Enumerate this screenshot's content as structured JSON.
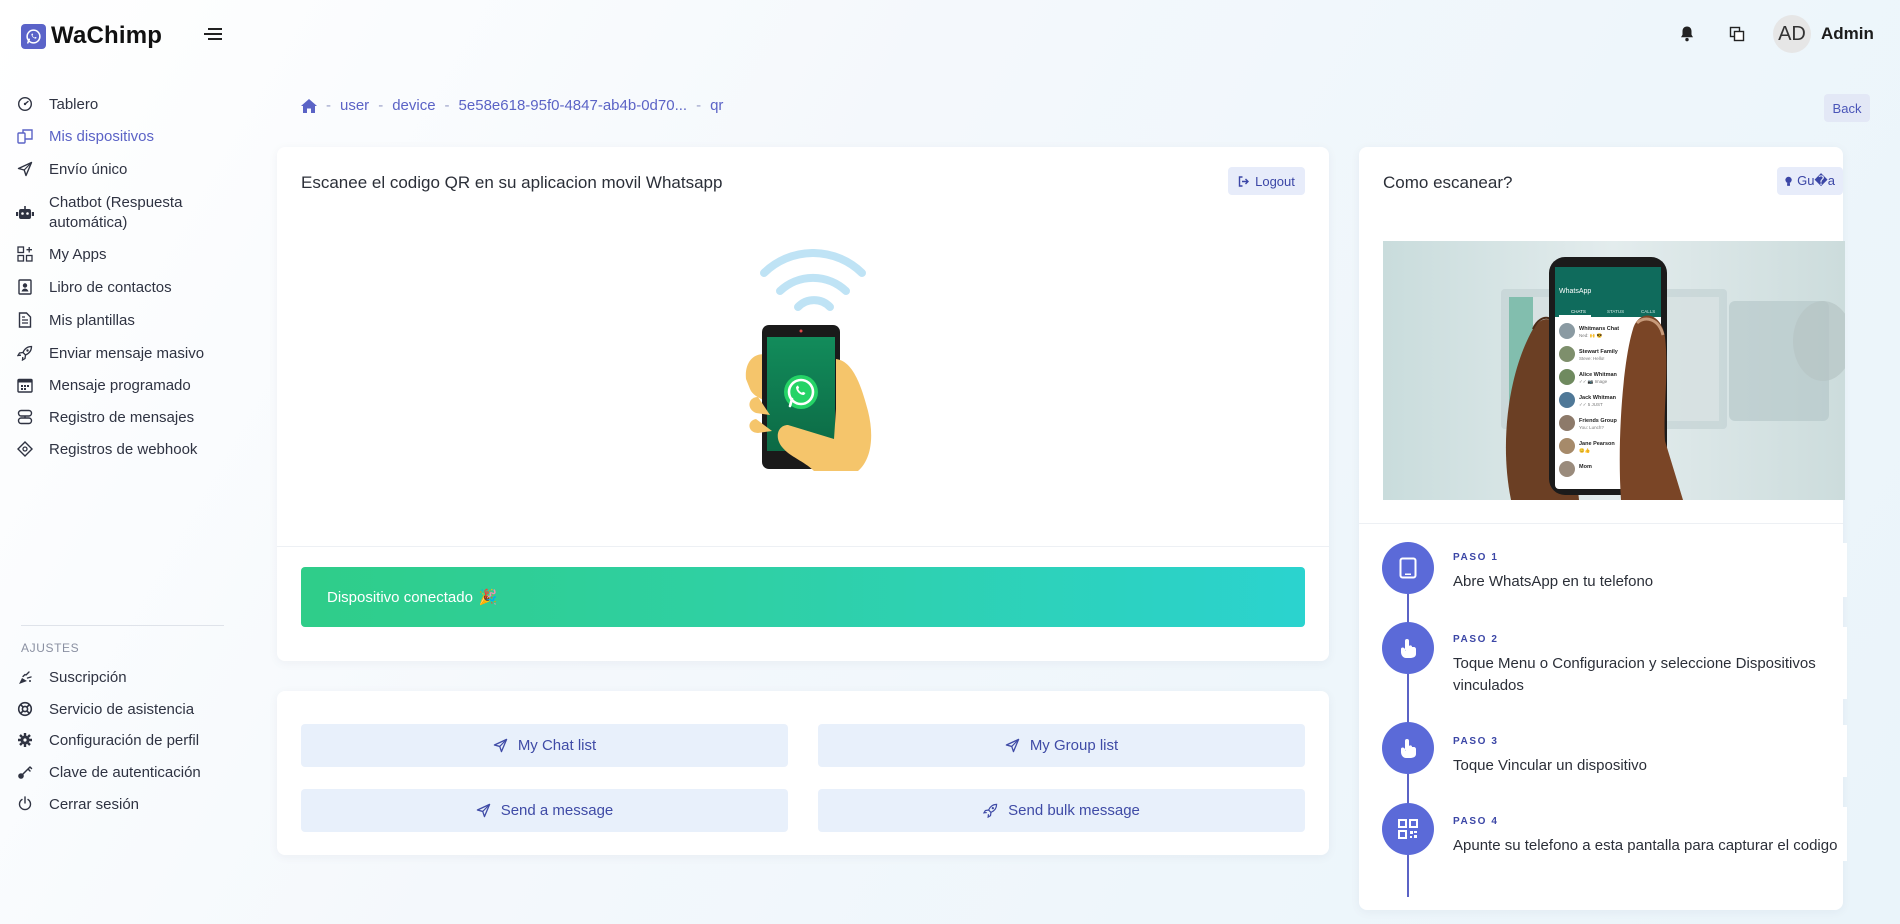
{
  "brand": {
    "name": "WaChimp"
  },
  "header": {
    "avatar_initials": "AD",
    "user_name": "Admin"
  },
  "sidebar": {
    "items": [
      {
        "label": "Tablero",
        "icon": "dashboard-icon"
      },
      {
        "label": "Mis dispositivos",
        "icon": "devices-icon",
        "active": true
      },
      {
        "label": "Envío único",
        "icon": "send-icon"
      },
      {
        "label": "Chatbot (Respuesta automática)",
        "icon": "robot-icon"
      },
      {
        "label": "My Apps",
        "icon": "apps-icon"
      },
      {
        "label": "Libro de contactos",
        "icon": "contacts-icon"
      },
      {
        "label": "Mis plantillas",
        "icon": "templates-icon"
      },
      {
        "label": "Enviar mensaje masivo",
        "icon": "rocket-icon"
      },
      {
        "label": "Mensaje programado",
        "icon": "calendar-icon"
      },
      {
        "label": "Registro de mensajes",
        "icon": "message-log-icon"
      },
      {
        "label": "Registros de webhook",
        "icon": "webhook-icon"
      }
    ],
    "settings_label": "AJUSTES",
    "settings_items": [
      {
        "label": "Suscripción",
        "icon": "subscription-icon"
      },
      {
        "label": "Servicio de asistencia",
        "icon": "support-icon"
      },
      {
        "label": "Configuración de perfil",
        "icon": "gear-icon"
      },
      {
        "label": "Clave de autenticación",
        "icon": "key-icon"
      },
      {
        "label": "Cerrar sesión",
        "icon": "power-icon"
      }
    ]
  },
  "breadcrumb": {
    "items": [
      "user",
      "device",
      "5e58e618-95f0-4847-ab4b-0d70...",
      "qr"
    ],
    "back_label": "Back"
  },
  "qr_card": {
    "title": "Escanee el codigo QR en su aplicacion movil Whatsapp",
    "logout_label": "Logout",
    "status_text": "Dispositivo conectado",
    "status_emoji": "🎉"
  },
  "actions": {
    "chat_list": "My Chat list",
    "group_list": "My Group list",
    "send_message": "Send a message",
    "send_bulk": "Send bulk message"
  },
  "guide_card": {
    "title": "Como escanear?",
    "guide_label": "Gu�a",
    "steps": [
      {
        "label": "PASO 1",
        "text": "Abre WhatsApp en tu telefono",
        "icon": "tablet-icon"
      },
      {
        "label": "PASO 2",
        "text": "Toque Menu o Configuracion y seleccione Dispositivos vinculados",
        "icon": "tap-hand-icon"
      },
      {
        "label": "PASO 3",
        "text": "Toque Vincular un dispositivo",
        "icon": "tap-hand-icon"
      },
      {
        "label": "PASO 4",
        "text": "Apunte su telefono a esta pantalla para capturar el codigo",
        "icon": "qrcode-icon"
      }
    ]
  },
  "phone_mockup": {
    "app_title": "WhatsApp",
    "tabs": [
      "CHATS",
      "STATUS",
      "CALLS"
    ],
    "chats": [
      {
        "name": "Whitmans Chat",
        "snippet": "Ned: 🙌 😎"
      },
      {
        "name": "Stewart Family",
        "snippet": "Steve: Hello!"
      },
      {
        "name": "Alice Whitman",
        "snippet": "✓✓ 📷 Image"
      },
      {
        "name": "Jack Whitman",
        "snippet": "✓✓ 5 JUST"
      },
      {
        "name": "Friends Group",
        "snippet": "You: Lunch?"
      },
      {
        "name": "Jane Pearson",
        "snippet": "😊👍"
      },
      {
        "name": "Mom",
        "snippet": ""
      }
    ]
  },
  "colors": {
    "accent": "#5b63c6",
    "success_start": "#2fcd89",
    "success_end": "#2bd3cf",
    "whatsapp_green": "#25d366"
  }
}
